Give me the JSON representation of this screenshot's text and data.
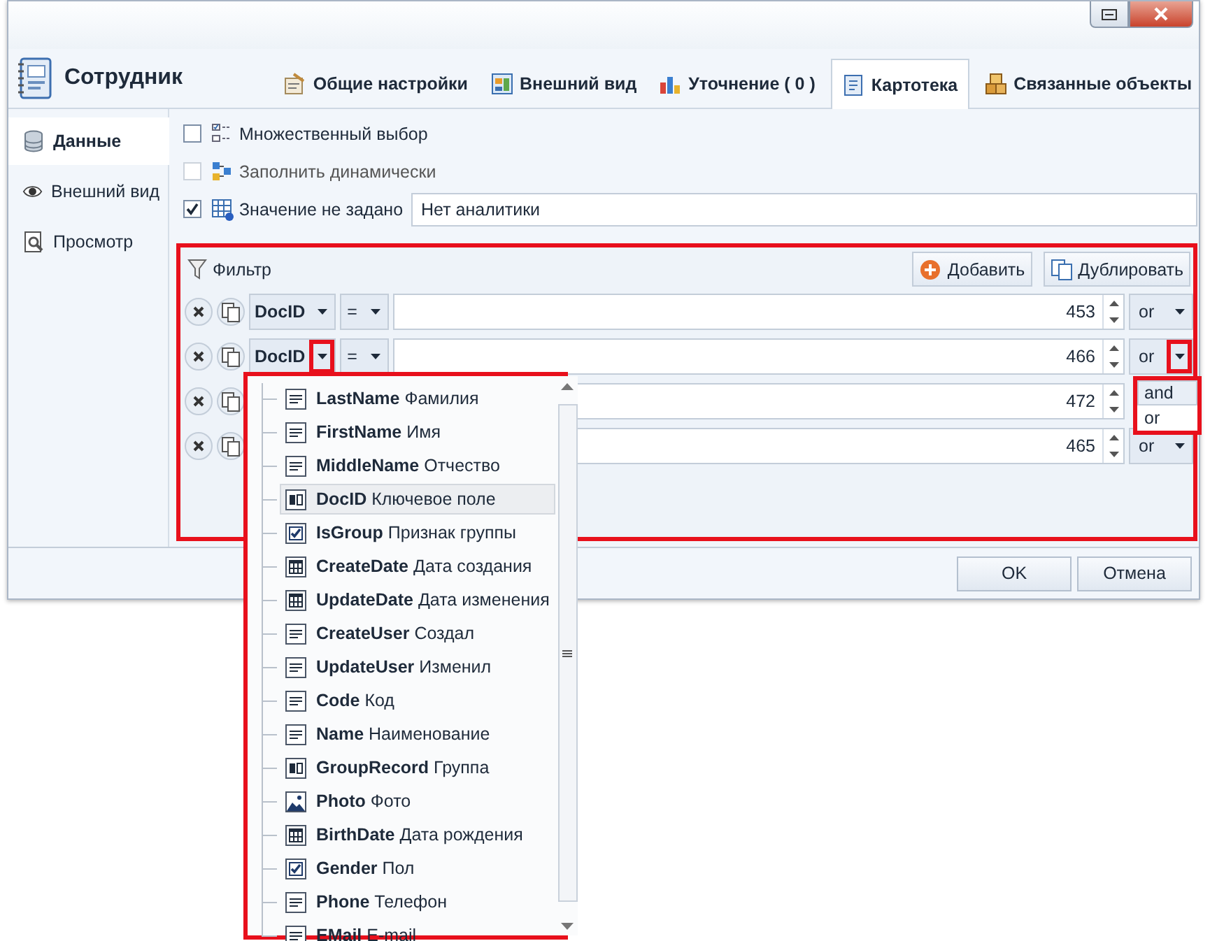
{
  "window": {
    "title": "Сотрудник"
  },
  "tabs": [
    {
      "label": "Общие настройки",
      "selected": false
    },
    {
      "label": "Внешний вид",
      "selected": false
    },
    {
      "label": "Уточнение ( 0 )",
      "selected": false
    },
    {
      "label": "Картотека",
      "selected": true
    },
    {
      "label": "Связанные объекты",
      "selected": false
    }
  ],
  "sidebar": {
    "items": [
      {
        "label": "Данные",
        "selected": true
      },
      {
        "label": "Внешний вид",
        "selected": false
      },
      {
        "label": "Просмотр",
        "selected": false
      }
    ]
  },
  "options": [
    {
      "label": "Множественный выбор",
      "checked": false,
      "disabled": false
    },
    {
      "label": "Заполнить динамически",
      "checked": false,
      "disabled": true
    },
    {
      "label": "Значение не задано",
      "checked": true,
      "disabled": false,
      "value": "Нет аналитики"
    }
  ],
  "filter": {
    "title": "Фильтр",
    "buttons": [
      "Добавить",
      "Дублировать"
    ],
    "rows": [
      {
        "field": "DocID",
        "field_caret_marked": false,
        "operator": "=",
        "value": "453",
        "logic": "or",
        "logic_caret_marked": false
      },
      {
        "field": "DocID",
        "field_caret_marked": true,
        "operator": "=",
        "value": "466",
        "logic": "or",
        "logic_caret_marked": true
      },
      {
        "value": "472"
      },
      {
        "value": "465",
        "logic": "or",
        "logic_caret_marked": false
      }
    ]
  },
  "field_menu": {
    "items": [
      {
        "text": "**LastName** Фамилия",
        "kind": "text",
        "selected": false
      },
      {
        "text": "**FirstName** Имя",
        "kind": "text",
        "selected": false
      },
      {
        "text": "**MiddleName** Отчество",
        "kind": "text",
        "selected": false
      },
      {
        "text": "**DocID** Ключевое поле",
        "kind": "key",
        "selected": true
      },
      {
        "text": "**IsGroup** Признак группы",
        "kind": "check",
        "selected": false
      },
      {
        "text": "**CreateDate** Дата создания",
        "kind": "date",
        "selected": false
      },
      {
        "text": "**UpdateDate** Дата изменения",
        "kind": "date",
        "selected": false
      },
      {
        "text": "**CreateUser** Создал",
        "kind": "text",
        "selected": false
      },
      {
        "text": "**UpdateUser** Изменил",
        "kind": "text",
        "selected": false
      },
      {
        "text": "**Code** Код",
        "kind": "text",
        "selected": false
      },
      {
        "text": "**Name** Наименование",
        "kind": "text",
        "selected": false
      },
      {
        "text": "**GroupRecord** Группа",
        "kind": "key",
        "selected": false
      },
      {
        "text": "**Photo** Фото",
        "kind": "image",
        "selected": false
      },
      {
        "text": "**BirthDate** Дата рождения",
        "kind": "date",
        "selected": false
      },
      {
        "text": "**Gender** Пол",
        "kind": "check",
        "selected": false
      },
      {
        "text": "**Phone** Телефон",
        "kind": "text",
        "selected": false
      },
      {
        "text": "**EMail** E-mail",
        "kind": "text",
        "selected": false
      }
    ]
  },
  "logic_menu": {
    "items": [
      {
        "label": "and",
        "selected": true
      },
      {
        "label": "or",
        "selected": false
      }
    ]
  },
  "footer": {
    "buttons": [
      "OK",
      "Отмена"
    ]
  }
}
